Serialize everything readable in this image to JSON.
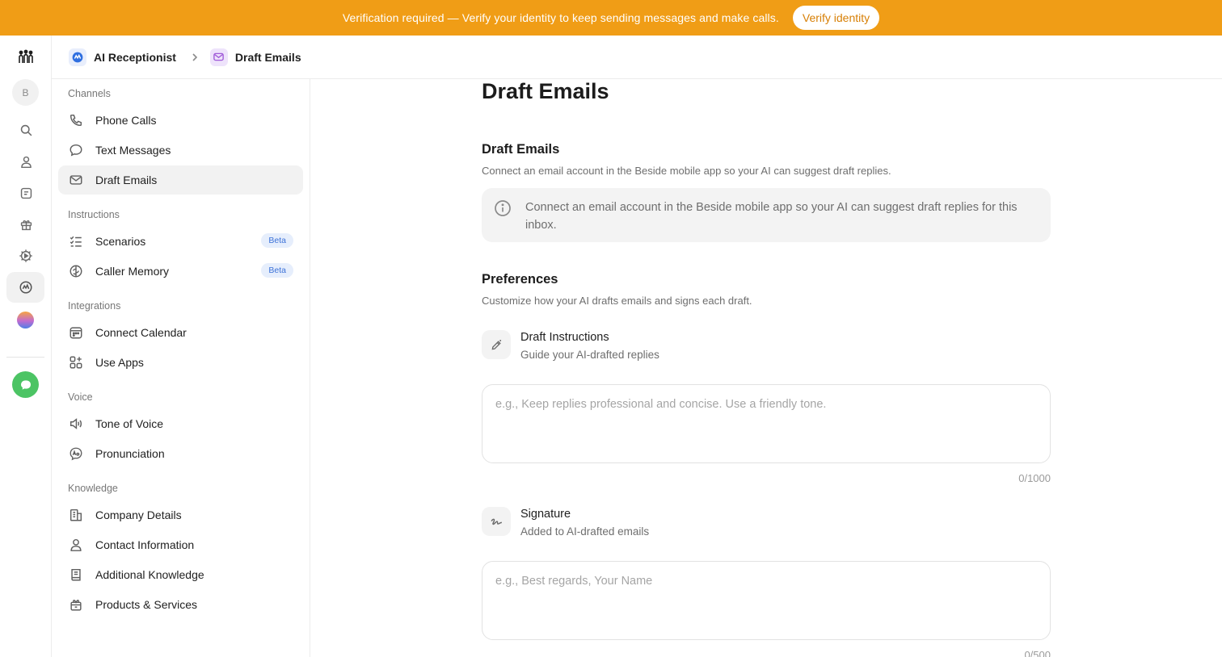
{
  "banner": {
    "text": "Verification required — Verify your identity to keep sending messages and make calls.",
    "button_label": "Verify identity",
    "background": "#f09d16"
  },
  "rail": {
    "logo_icon": "people-group-icon",
    "avatar_letter": "B",
    "items": [
      "search-icon",
      "person-icon",
      "notes-icon",
      "gift-icon",
      "settings-play-icon",
      "ai-receptionist-icon",
      "gradient-orb-icon",
      "chat-bubble-icon"
    ]
  },
  "breadcrumb": {
    "parent": "AI Receptionist",
    "current": "Draft Emails"
  },
  "sidebar": {
    "sections": [
      {
        "label": "Channels",
        "items": [
          {
            "label": "Phone Calls",
            "icon": "phone-icon"
          },
          {
            "label": "Text Messages",
            "icon": "chat-icon"
          },
          {
            "label": "Draft Emails",
            "icon": "mail-icon",
            "active": true
          }
        ]
      },
      {
        "label": "Instructions",
        "items": [
          {
            "label": "Scenarios",
            "icon": "checklist-icon",
            "badge": "Beta"
          },
          {
            "label": "Caller Memory",
            "icon": "brain-icon",
            "badge": "Beta"
          }
        ]
      },
      {
        "label": "Integrations",
        "items": [
          {
            "label": "Connect Calendar",
            "icon": "calendar-icon"
          },
          {
            "label": "Use Apps",
            "icon": "apps-icon"
          }
        ]
      },
      {
        "label": "Voice",
        "items": [
          {
            "label": "Tone of Voice",
            "icon": "speaker-icon"
          },
          {
            "label": "Pronunciation",
            "icon": "pronunciation-icon"
          }
        ]
      },
      {
        "label": "Knowledge",
        "items": [
          {
            "label": "Company Details",
            "icon": "building-icon"
          },
          {
            "label": "Contact Information",
            "icon": "person-icon"
          },
          {
            "label": "Additional Knowledge",
            "icon": "book-icon"
          },
          {
            "label": "Products & Services",
            "icon": "box-icon"
          }
        ]
      }
    ]
  },
  "main": {
    "title": "Draft Emails",
    "draft_section": {
      "title": "Draft Emails",
      "description": "Connect an email account in the Beside mobile app so your AI can suggest draft replies.",
      "info_text": "Connect an email account in the Beside mobile app so your AI can suggest draft replies for this inbox."
    },
    "preferences": {
      "title": "Preferences",
      "description": "Customize how your AI drafts emails and signs each draft.",
      "instructions": {
        "title": "Draft Instructions",
        "subtitle": "Guide your AI-drafted replies",
        "placeholder": "e.g., Keep replies professional and concise. Use a friendly tone.",
        "counter": "0/1000"
      },
      "signature": {
        "title": "Signature",
        "subtitle": "Added to AI-drafted emails",
        "placeholder": "e.g., Best regards, Your Name",
        "counter": "0/500"
      }
    }
  }
}
